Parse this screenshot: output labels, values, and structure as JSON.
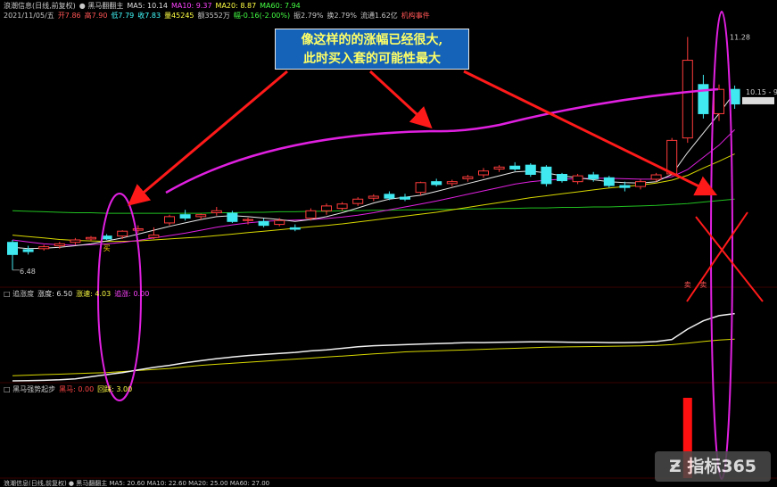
{
  "header_main": {
    "row1": [
      {
        "text": "浪潮信息(日线,前复权)",
        "color": "#c8c8c8"
      },
      {
        "text": "● 黑马翻翻主",
        "color": "#c8c8c8"
      },
      {
        "text": "MA5: 10.14",
        "color": "#e0e0e0"
      },
      {
        "text": "MA10: 9.37",
        "color": "#ff44ff"
      },
      {
        "text": "MA20: 8.87",
        "color": "#ffff44"
      },
      {
        "text": "MA60: 7.94",
        "color": "#44ff44"
      }
    ],
    "row2": [
      {
        "text": "2021/11/05/五",
        "color": "#c8c8c8"
      },
      {
        "text": "开7.86",
        "color": "#ff5555"
      },
      {
        "text": "高7.90",
        "color": "#ff5555"
      },
      {
        "text": "低7.79",
        "color": "#44ffff"
      },
      {
        "text": "收7.83",
        "color": "#44ffff"
      },
      {
        "text": "量45245",
        "color": "#ffff44"
      },
      {
        "text": "额3552万",
        "color": "#c8c8c8"
      },
      {
        "text": "幅-0.16(-2.00%)",
        "color": "#44ff44"
      },
      {
        "text": "振2.79%",
        "color": "#c8c8c8"
      },
      {
        "text": "换2.79%",
        "color": "#c8c8c8"
      },
      {
        "text": "流通1.62亿",
        "color": "#c8c8c8"
      },
      {
        "text": "机构事件",
        "color": "#ff5555"
      }
    ]
  },
  "header_sub1": [
    {
      "text": "□ 追涨度",
      "color": "#c8c8c8"
    },
    {
      "text": "涨度: 6.50",
      "color": "#e0e0e0"
    },
    {
      "text": "涨速: 4.03",
      "color": "#ffff44"
    },
    {
      "text": "追涨: 0.00",
      "color": "#ff44ff"
    }
  ],
  "header_sub2": [
    {
      "text": "□ 黑马强势起步",
      "color": "#c8c8c8"
    },
    {
      "text": "黑马: 0.00",
      "color": "#ff4444"
    },
    {
      "text": "回踩: 3.00",
      "color": "#ffff44"
    }
  ],
  "header_bottom": {
    "text": "浪潮信息(日线,前复权)  ● 黑马翻翻主  MA5: 20.60  MA10: 22.60  MA20: 25.00  MA60: 27.00",
    "color": "#c8c8c8"
  },
  "callout": {
    "line1": "像这样的的涨幅已经很大,",
    "line2": "此时买入套的可能性最大"
  },
  "top_right": {
    "text": "",
    "color": "#aaa"
  },
  "logo": {
    "text": "指标365"
  },
  "colors": {
    "up": "#ff3b3b",
    "down": "#40e8f0",
    "ma5": "#e8e8e8",
    "ma10": "#e020e0",
    "ma20": "#d8d800",
    "ma60": "#20c020",
    "arrow": "#ff1a1a",
    "ellipse": "#e020e0"
  },
  "chart_data": {
    "type": "candlestick",
    "ylim": [
      6.2,
      11.6
    ],
    "price_labels": [
      {
        "text": "11.28",
        "value": 11.28
      },
      {
        "text": "10.15 - 9.",
        "value": 10.15
      },
      {
        "text": "6.48",
        "value": 6.48
      }
    ],
    "markers": [
      {
        "text": "买",
        "index": 6
      },
      {
        "text": "卖",
        "index": 43
      },
      {
        "text": "卖",
        "index": 44
      }
    ],
    "candles": [
      {
        "o": 7.05,
        "h": 7.1,
        "l": 6.48,
        "c": 6.8
      },
      {
        "o": 6.9,
        "h": 6.98,
        "l": 6.8,
        "c": 6.86
      },
      {
        "o": 6.92,
        "h": 7.0,
        "l": 6.88,
        "c": 6.96
      },
      {
        "o": 6.98,
        "h": 7.06,
        "l": 6.92,
        "c": 7.02
      },
      {
        "o": 7.05,
        "h": 7.14,
        "l": 7.0,
        "c": 7.1
      },
      {
        "o": 7.12,
        "h": 7.18,
        "l": 7.08,
        "c": 7.15
      },
      {
        "o": 7.18,
        "h": 7.22,
        "l": 7.1,
        "c": 7.12
      },
      {
        "o": 7.18,
        "h": 7.3,
        "l": 7.12,
        "c": 7.28
      },
      {
        "o": 7.3,
        "h": 7.4,
        "l": 7.25,
        "c": 7.33
      },
      {
        "o": 7.15,
        "h": 7.36,
        "l": 7.12,
        "c": 7.2
      },
      {
        "o": 7.45,
        "h": 7.62,
        "l": 7.4,
        "c": 7.58
      },
      {
        "o": 7.62,
        "h": 7.72,
        "l": 7.5,
        "c": 7.55
      },
      {
        "o": 7.58,
        "h": 7.64,
        "l": 7.52,
        "c": 7.62
      },
      {
        "o": 7.66,
        "h": 7.78,
        "l": 7.6,
        "c": 7.7
      },
      {
        "o": 7.65,
        "h": 7.7,
        "l": 7.45,
        "c": 7.48
      },
      {
        "o": 7.5,
        "h": 7.56,
        "l": 7.42,
        "c": 7.52
      },
      {
        "o": 7.48,
        "h": 7.54,
        "l": 7.36,
        "c": 7.4
      },
      {
        "o": 7.42,
        "h": 7.55,
        "l": 7.38,
        "c": 7.5
      },
      {
        "o": 7.35,
        "h": 7.42,
        "l": 7.28,
        "c": 7.32
      },
      {
        "o": 7.55,
        "h": 7.75,
        "l": 7.5,
        "c": 7.7
      },
      {
        "o": 7.7,
        "h": 7.85,
        "l": 7.62,
        "c": 7.8
      },
      {
        "o": 7.75,
        "h": 7.88,
        "l": 7.7,
        "c": 7.84
      },
      {
        "o": 7.85,
        "h": 7.98,
        "l": 7.8,
        "c": 7.94
      },
      {
        "o": 7.96,
        "h": 8.04,
        "l": 7.9,
        "c": 8.0
      },
      {
        "o": 8.04,
        "h": 8.1,
        "l": 7.92,
        "c": 7.96
      },
      {
        "o": 7.98,
        "h": 8.05,
        "l": 7.9,
        "c": 7.94
      },
      {
        "o": 8.08,
        "h": 8.3,
        "l": 8.02,
        "c": 8.28
      },
      {
        "o": 8.3,
        "h": 8.36,
        "l": 8.2,
        "c": 8.24
      },
      {
        "o": 8.26,
        "h": 8.34,
        "l": 8.2,
        "c": 8.3
      },
      {
        "o": 8.36,
        "h": 8.44,
        "l": 8.3,
        "c": 8.4
      },
      {
        "o": 8.44,
        "h": 8.58,
        "l": 8.38,
        "c": 8.52
      },
      {
        "o": 8.56,
        "h": 8.64,
        "l": 8.5,
        "c": 8.6
      },
      {
        "o": 8.62,
        "h": 8.7,
        "l": 8.52,
        "c": 8.56
      },
      {
        "o": 8.64,
        "h": 8.68,
        "l": 8.4,
        "c": 8.45
      },
      {
        "o": 8.6,
        "h": 8.64,
        "l": 8.2,
        "c": 8.26
      },
      {
        "o": 8.45,
        "h": 8.48,
        "l": 8.28,
        "c": 8.32
      },
      {
        "o": 8.3,
        "h": 8.46,
        "l": 8.25,
        "c": 8.42
      },
      {
        "o": 8.44,
        "h": 8.5,
        "l": 8.3,
        "c": 8.36
      },
      {
        "o": 8.38,
        "h": 8.42,
        "l": 8.18,
        "c": 8.22
      },
      {
        "o": 8.22,
        "h": 8.3,
        "l": 8.1,
        "c": 8.18
      },
      {
        "o": 8.2,
        "h": 8.34,
        "l": 8.14,
        "c": 8.3
      },
      {
        "o": 8.35,
        "h": 8.48,
        "l": 8.3,
        "c": 8.44
      },
      {
        "o": 8.46,
        "h": 9.2,
        "l": 8.42,
        "c": 9.15
      },
      {
        "o": 9.2,
        "h": 11.28,
        "l": 9.1,
        "c": 10.8
      },
      {
        "o": 10.3,
        "h": 10.5,
        "l": 9.6,
        "c": 9.7
      },
      {
        "o": 9.7,
        "h": 10.3,
        "l": 9.55,
        "c": 10.2
      },
      {
        "o": 10.2,
        "h": 10.28,
        "l": 9.8,
        "c": 9.9
      }
    ],
    "ma5": [
      6.95,
      6.92,
      6.93,
      6.95,
      6.98,
      7.02,
      7.08,
      7.14,
      7.22,
      7.3,
      7.38,
      7.45,
      7.52,
      7.58,
      7.6,
      7.58,
      7.55,
      7.52,
      7.48,
      7.52,
      7.58,
      7.66,
      7.76,
      7.86,
      7.94,
      7.98,
      8.02,
      8.1,
      8.18,
      8.26,
      8.34,
      8.42,
      8.5,
      8.52,
      8.48,
      8.42,
      8.38,
      8.34,
      8.3,
      8.28,
      8.27,
      8.3,
      8.45,
      8.9,
      9.3,
      9.7,
      10.14
    ],
    "ma10": [
      7.1,
      7.06,
      7.02,
      7.0,
      6.99,
      7.0,
      7.02,
      7.05,
      7.09,
      7.14,
      7.19,
      7.24,
      7.3,
      7.36,
      7.41,
      7.45,
      7.48,
      7.5,
      7.51,
      7.52,
      7.54,
      7.57,
      7.61,
      7.66,
      7.72,
      7.78,
      7.84,
      7.9,
      7.97,
      8.04,
      8.11,
      8.18,
      8.25,
      8.3,
      8.33,
      8.35,
      8.36,
      8.37,
      8.37,
      8.36,
      8.35,
      8.35,
      8.4,
      8.55,
      8.8,
      9.05,
      9.37
    ],
    "ma20": [
      7.2,
      7.17,
      7.14,
      7.11,
      7.09,
      7.08,
      7.07,
      7.07,
      7.08,
      7.1,
      7.12,
      7.14,
      7.16,
      7.19,
      7.22,
      7.25,
      7.28,
      7.31,
      7.34,
      7.37,
      7.4,
      7.43,
      7.47,
      7.51,
      7.55,
      7.59,
      7.63,
      7.67,
      7.72,
      7.77,
      7.82,
      7.87,
      7.92,
      7.97,
      8.01,
      8.05,
      8.09,
      8.13,
      8.17,
      8.2,
      8.23,
      8.27,
      8.33,
      8.43,
      8.58,
      8.72,
      8.87
    ],
    "ma60": [
      7.7,
      7.69,
      7.68,
      7.67,
      7.66,
      7.66,
      7.65,
      7.65,
      7.65,
      7.65,
      7.65,
      7.65,
      7.65,
      7.66,
      7.66,
      7.67,
      7.67,
      7.68,
      7.68,
      7.69,
      7.69,
      7.7,
      7.7,
      7.71,
      7.71,
      7.72,
      7.72,
      7.73,
      7.73,
      7.74,
      7.74,
      7.75,
      7.75,
      7.76,
      7.76,
      7.77,
      7.77,
      7.78,
      7.78,
      7.79,
      7.8,
      7.81,
      7.83,
      7.85,
      7.88,
      7.91,
      7.94
    ],
    "indicator": {
      "ylim": [
        0,
        7.5
      ],
      "line": [
        0.0,
        0.02,
        0.05,
        0.1,
        0.2,
        0.4,
        0.6,
        0.8,
        1.05,
        1.3,
        1.5,
        1.75,
        1.95,
        2.15,
        2.3,
        2.45,
        2.55,
        2.65,
        2.75,
        2.9,
        3.0,
        3.15,
        3.3,
        3.4,
        3.45,
        3.5,
        3.55,
        3.6,
        3.65,
        3.7,
        3.7,
        3.72,
        3.75,
        3.78,
        3.78,
        3.75,
        3.72,
        3.72,
        3.7,
        3.7,
        3.72,
        3.8,
        4.0,
        5.0,
        5.8,
        6.3,
        6.5
      ],
      "signal": [
        0.5,
        0.55,
        0.6,
        0.65,
        0.7,
        0.75,
        0.8,
        0.9,
        1.0,
        1.1,
        1.2,
        1.35,
        1.5,
        1.6,
        1.7,
        1.8,
        1.9,
        2.0,
        2.1,
        2.2,
        2.3,
        2.4,
        2.5,
        2.6,
        2.7,
        2.8,
        2.85,
        2.9,
        2.95,
        3.0,
        3.05,
        3.1,
        3.15,
        3.2,
        3.25,
        3.28,
        3.3,
        3.32,
        3.34,
        3.36,
        3.38,
        3.42,
        3.5,
        3.65,
        3.8,
        3.95,
        4.03
      ]
    },
    "volume_bars": [
      {
        "index": 43,
        "value": 1.0
      }
    ]
  }
}
